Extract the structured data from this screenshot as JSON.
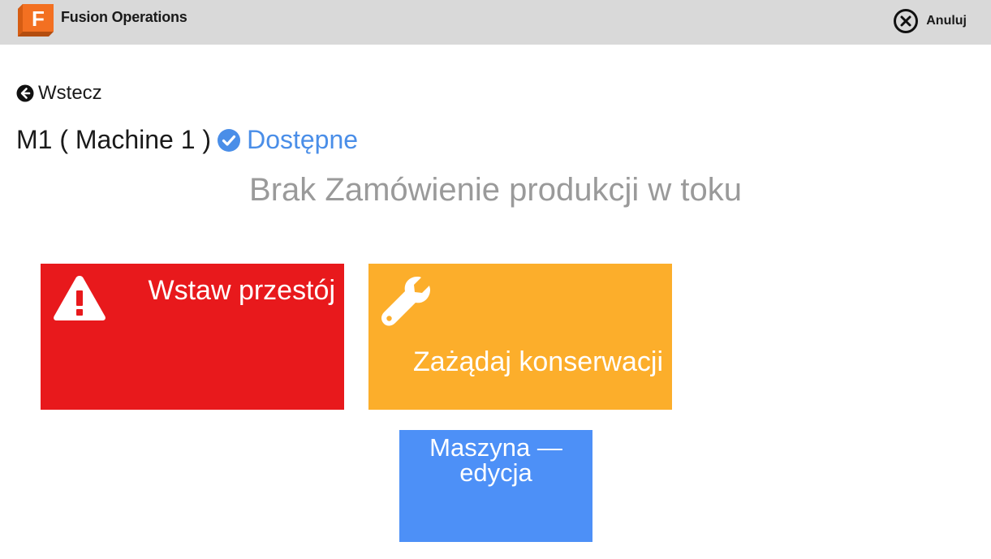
{
  "header": {
    "app_title": "Fusion Operations",
    "logo_letter": "F",
    "logo_icon": "fusion-logo",
    "cancel_label": "Anuluj",
    "cancel_icon": "close-circle-icon"
  },
  "nav": {
    "back_label": "Wstecz",
    "back_icon": "arrow-left-circle-icon"
  },
  "machine": {
    "name": "M1 ( Machine 1 )",
    "status": "Dostępne",
    "status_icon": "check-circle-icon",
    "status_color": "#4a8ee8"
  },
  "order_status": "Brak Zamówienie produkcji w toku",
  "tiles": {
    "downtime": {
      "label": "Wstaw przestój",
      "icon": "warning-triangle-icon",
      "color": "#e8191c"
    },
    "maintenance": {
      "label": "Zażądaj konserwacji",
      "icon": "wrench-icon",
      "color": "#fcae2b"
    },
    "machine_edit": {
      "label_line1": "Maszyna —",
      "label_line2": "edycja",
      "color": "#4d90f7"
    }
  }
}
